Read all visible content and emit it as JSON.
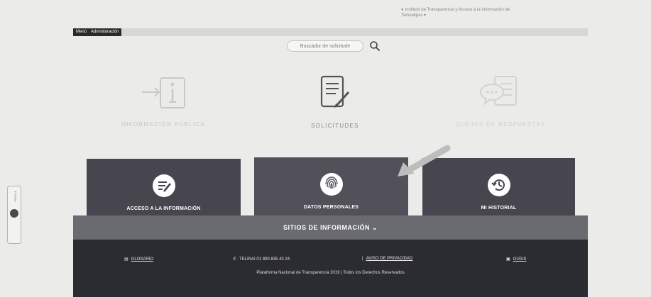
{
  "topnote": {
    "text": "Instituto de Transparencia y Acceso a la Información de Tamaulipas ▾"
  },
  "menu": {
    "label1": "Menú",
    "label2": "Administración"
  },
  "search": {
    "placeholder": "Buscador de solicitude"
  },
  "icons": [
    {
      "label": "INFORMACIÓN PÚBLICA",
      "icon": "info-document-icon"
    },
    {
      "label": "SOLICITUDES",
      "icon": "document-pencil-icon"
    },
    {
      "label": "QUEJAS DE RESPUESTAS",
      "icon": "chat-document-icon"
    }
  ],
  "cards": [
    {
      "label": "ACCESO A LA INFORMACIÓN",
      "icon": "edit-note-icon"
    },
    {
      "label": "DATOS PERSONALES",
      "icon": "fingerprint-icon"
    },
    {
      "label": "MI HISTORIAL",
      "icon": "history-clock-icon"
    }
  ],
  "sitios": {
    "label": "SITIOS DE INFORMACIÓN"
  },
  "footer": {
    "glosario": "GLOSARIO",
    "tel": "TELINAI 01 800 835 43 24",
    "aviso": "AVISO DE PRIVACIDAD",
    "guias": "GUÍAS",
    "copyright": "Plataforma Nacional de Transparencia 2019 | Todos los Derechos Reservados"
  },
  "sidetab": {
    "label": "ESCALA"
  },
  "colors": {
    "card": "#47464f",
    "footer": "#2b2b32",
    "band": "#6a6a71"
  }
}
